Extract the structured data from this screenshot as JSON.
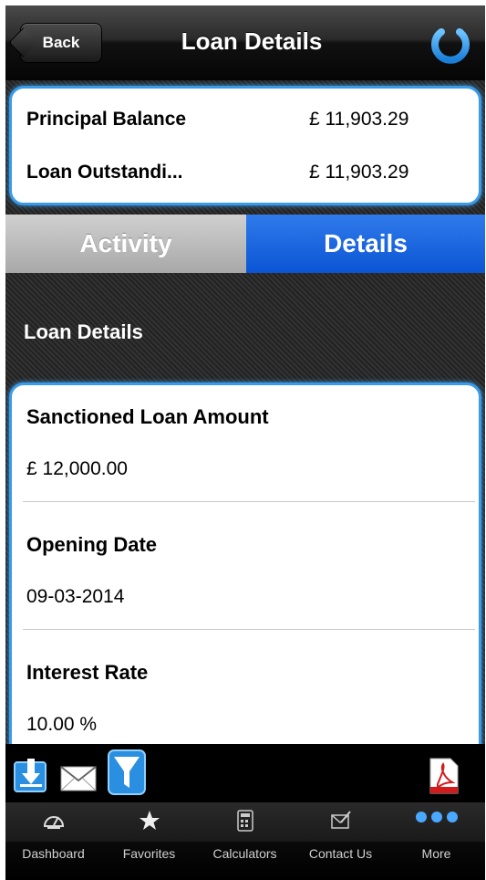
{
  "header": {
    "back_label": "Back",
    "title": "Loan Details",
    "power_icon": "power-icon"
  },
  "summary": {
    "rows": [
      {
        "label": "Principal Balance",
        "value": "£ 11,903.29"
      },
      {
        "label": "Loan Outstandi...",
        "value": "£ 11,903.29"
      }
    ]
  },
  "tabs": [
    {
      "label": "Activity",
      "selected": false
    },
    {
      "label": "Details",
      "selected": true
    }
  ],
  "section": {
    "title": "Loan Details",
    "fields": [
      {
        "label": "Sanctioned Loan Amount",
        "value": "£ 12,000.00"
      },
      {
        "label": "Opening Date",
        "value": "09-03-2014"
      },
      {
        "label": "Interest Rate",
        "value": "10.00 %"
      }
    ]
  },
  "actions": {
    "download_icon": "download-icon",
    "mail_icon": "mail-icon",
    "filter_icon": "filter-icon",
    "pdf_icon": "pdf-icon"
  },
  "tab_bar": [
    {
      "label": "Dashboard",
      "icon": "dashboard-icon"
    },
    {
      "label": "Favorites",
      "icon": "star-icon"
    },
    {
      "label": "Calculators",
      "icon": "calculator-icon"
    },
    {
      "label": "Contact Us",
      "icon": "contact-icon"
    },
    {
      "label": "More",
      "icon": "more-icon"
    }
  ],
  "colors": {
    "accent_blue": "#0b55d5",
    "card_border": "#3a9be8"
  }
}
